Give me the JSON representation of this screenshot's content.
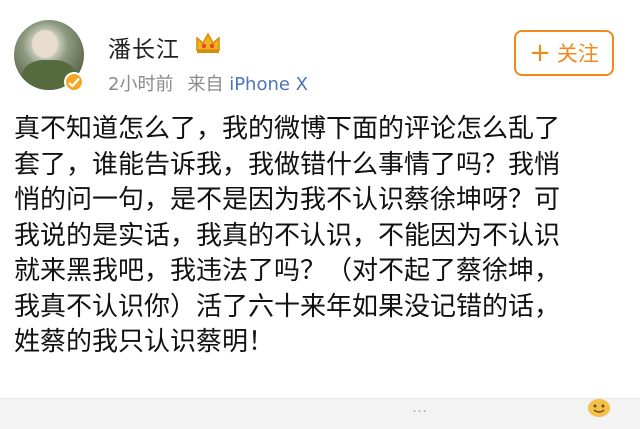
{
  "post": {
    "author": {
      "name": "潘长江",
      "avatar_icon": "user-avatar",
      "verified_icon": "verified-badge-icon",
      "vip_icon": "vip-crown-icon"
    },
    "time": "2小时前",
    "source_prefix": "来自",
    "source_device": "iPhone X",
    "follow_button": {
      "icon": "plus-icon",
      "plus": "+",
      "label": "关注"
    },
    "content_lines": [
      "真不知道怎么了，我的微博下面的评论怎么乱了",
      "套了，谁能告诉我，我做错什么事情了吗？我悄",
      "悄的问一句，是不是因为我不认识蔡徐坤呀？可",
      "我说的是实话，我真的不认识，不能因为不认识",
      "就来黑我吧，我违法了吗？（对不起了蔡徐坤，",
      "我真不认识你）活了六十来年如果没记错的话，",
      "姓蔡的我只认识蔡明！"
    ]
  },
  "bottom_bar": {
    "partial_text": "…",
    "emoji_icon": "emoji-icon"
  },
  "colors": {
    "accent": "#f08a1c",
    "link": "#4f74b5",
    "meta": "#8a8a8a",
    "verified": "#f5a623"
  }
}
